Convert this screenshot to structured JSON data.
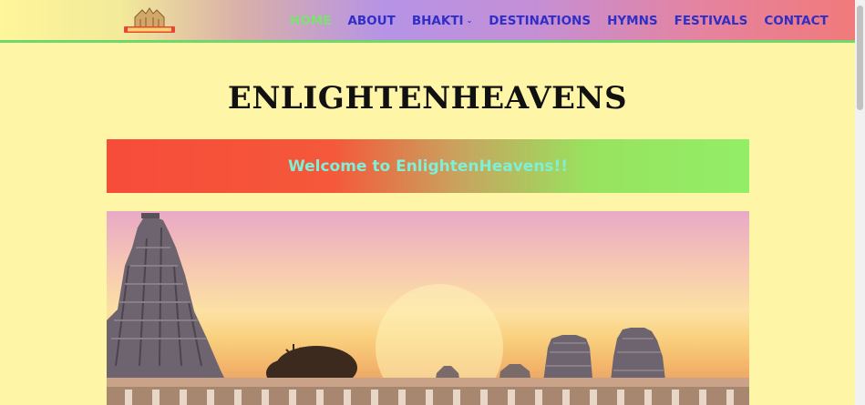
{
  "nav": {
    "items": [
      {
        "label": "HOME",
        "active": true
      },
      {
        "label": "ABOUT",
        "active": false
      },
      {
        "label": "BHAKTI",
        "active": false,
        "has_dropdown": true
      },
      {
        "label": "DESTINATIONS",
        "active": false
      },
      {
        "label": "HYMNS",
        "active": false
      },
      {
        "label": "FESTIVALS",
        "active": false
      },
      {
        "label": "CONTACT",
        "active": false
      }
    ]
  },
  "logo": {
    "icon": "temple-logo-icon"
  },
  "site_title": "ENLIGHTENHEAVENS",
  "banner": {
    "text": "Welcome to EnlightenHeavens!!"
  },
  "hero": {
    "icon": "temple-gopuram-image"
  },
  "colors": {
    "page_bg": "#fff5a6",
    "nav_text": "#2f2fc8",
    "nav_active": "#7be36f",
    "banner_text": "#7ff0d6",
    "header_line": "#6fd86b"
  }
}
